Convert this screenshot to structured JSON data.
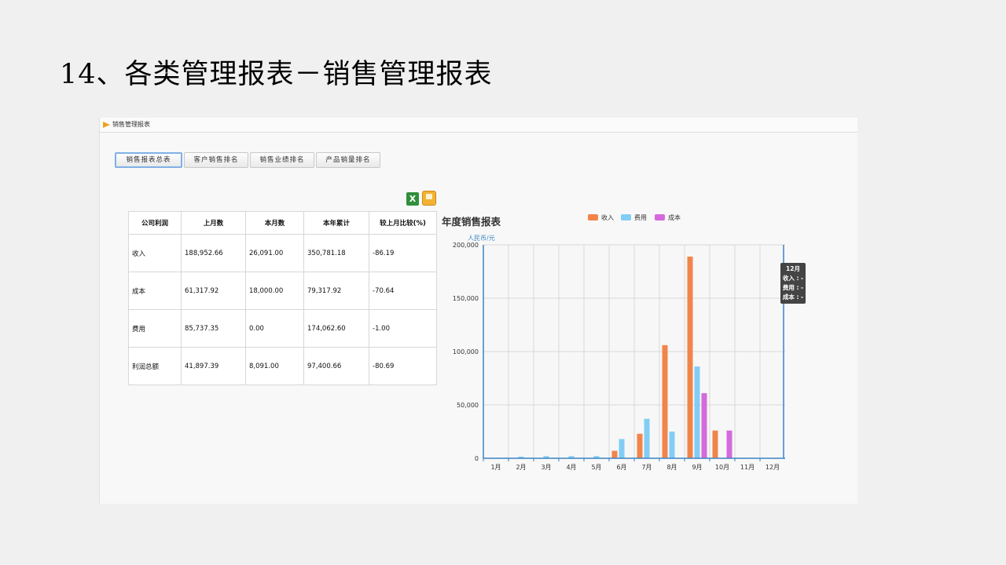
{
  "slide": {
    "title": "14、各类管理报表－销售管理报表"
  },
  "panel": {
    "header_title": "销售管理报表"
  },
  "tabs": [
    {
      "label": "销售报表总表",
      "active": true
    },
    {
      "label": "客户销售排名",
      "active": false
    },
    {
      "label": "销售业绩排名",
      "active": false
    },
    {
      "label": "产品销量排名",
      "active": false
    }
  ],
  "export": {
    "excel_glyph": "X"
  },
  "table": {
    "headers": [
      "公司利润",
      "上月数",
      "本月数",
      "本年累计",
      "较上月比较(%)"
    ],
    "rows": [
      [
        "收入",
        "188,952.66",
        "26,091.00",
        "350,781.18",
        "-86.19"
      ],
      [
        "成本",
        "61,317.92",
        "18,000.00",
        "79,317.92",
        "-70.64"
      ],
      [
        "费用",
        "85,737.35",
        "0.00",
        "174,062.60",
        "-1.00"
      ],
      [
        "利润总额",
        "41,897.39",
        "8,091.00",
        "97,400.66",
        "-80.69"
      ]
    ]
  },
  "chart_data": {
    "type": "bar",
    "title": "年度销售报表",
    "ylabel": "人民币/元",
    "ylim": [
      0,
      200000
    ],
    "yticks": [
      0,
      50000,
      100000,
      150000,
      200000
    ],
    "ytick_labels": [
      "0",
      "50,000",
      "100,000",
      "150,000",
      "200,000"
    ],
    "categories": [
      "1月",
      "2月",
      "3月",
      "4月",
      "5月",
      "6月",
      "7月",
      "8月",
      "9月",
      "10月",
      "11月",
      "12月"
    ],
    "grid": true,
    "legend_position": "top",
    "series": [
      {
        "name": "收入",
        "color": "#f2844a",
        "values": [
          0,
          0,
          0,
          0,
          0,
          7000,
          23000,
          106000,
          189000,
          26000,
          0,
          0
        ]
      },
      {
        "name": "费用",
        "color": "#82cdf5",
        "values": [
          0,
          1500,
          2000,
          2000,
          2000,
          18000,
          37000,
          25000,
          86000,
          0,
          0,
          0
        ]
      },
      {
        "name": "成本",
        "color": "#d46adb",
        "values": [
          0,
          0,
          0,
          0,
          0,
          0,
          0,
          0,
          61000,
          26000,
          0,
          0
        ]
      }
    ],
    "highlight_index": 11,
    "tooltip": {
      "title": "12月",
      "lines": [
        "收入 : -",
        "费用 : -",
        "成本 : -"
      ]
    }
  }
}
